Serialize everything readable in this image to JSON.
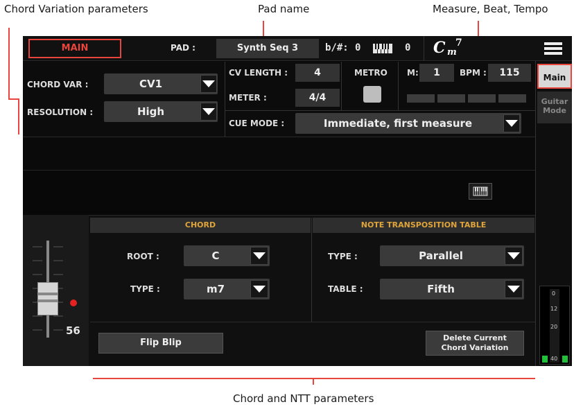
{
  "callouts": {
    "chord_variation_parameters": "Chord Variation parameters",
    "pad_name": "Pad name",
    "measure_beat_tempo": "Measure, Beat, Tempo",
    "chord_ntt_parameters": "Chord and NTT parameters"
  },
  "topbar": {
    "main_tab": "MAIN",
    "pad_label": "PAD :",
    "pad_name": "Synth Seq 3",
    "transpose_label": "b/#:",
    "transpose_value": "0",
    "keyboard_value": "0",
    "chord_root": "C",
    "chord_quality": "m",
    "chord_extension": "7"
  },
  "cv_panel": {
    "chord_var_label": "CHORD VAR :",
    "chord_var_value": "CV1",
    "resolution_label": "RESOLUTION :",
    "resolution_value": "High",
    "cv_length_label": "CV LENGTH :",
    "cv_length_value": "4",
    "meter_label": "METER :",
    "meter_value": "4/4",
    "metro_label": "METRO",
    "m_label": "M:",
    "m_value": "1",
    "bpm_label": "BPM :",
    "bpm_value": "115",
    "cue_mode_label": "CUE MODE :",
    "cue_mode_value": "Immediate, first measure"
  },
  "chord_section": {
    "title": "CHORD",
    "root_label": "ROOT :",
    "root_value": "C",
    "type_label": "TYPE :",
    "type_value": "m7"
  },
  "ntt_section": {
    "title": "NOTE TRANSPOSITION TABLE",
    "type_label": "TYPE :",
    "type_value": "Parallel",
    "table_label": "TABLE :",
    "table_value": "Fifth"
  },
  "fader": {
    "value": "56"
  },
  "buttons": {
    "flip_blip": "Flip Blip",
    "delete_line1": "Delete Current",
    "delete_line2": "Chord Variation"
  },
  "rightnav": {
    "main": "Main",
    "guitar_line1": "Guitar",
    "guitar_line2": "Mode"
  },
  "meter_ticks": [
    "0",
    "12",
    "20",
    "40"
  ],
  "colors": {
    "accent_red": "#e8453c",
    "section_title": "#e0a53a",
    "meter_green": "#22c03a"
  }
}
